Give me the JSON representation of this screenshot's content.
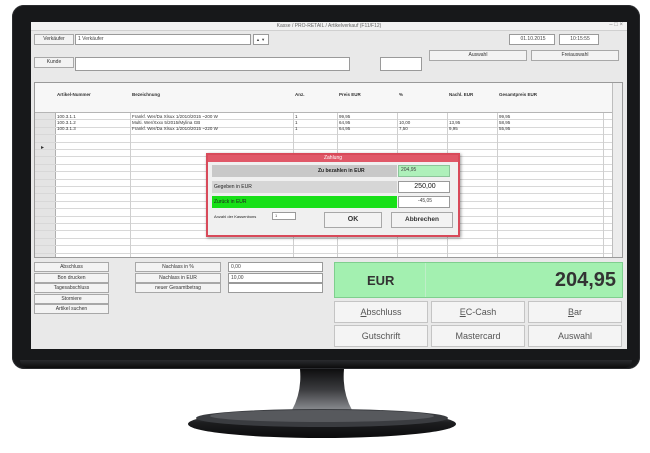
{
  "app": {
    "window_title": "Kasse / PRO-RETAIL / Artikelverkauf (F11/F12)",
    "window_controls": "–  □  ×"
  },
  "toolbar": {
    "verkaeufer_label": "Verkäufer",
    "verkaeufer_value": "1   Verkäufer",
    "verkaeufer_spin": "▲ ▼",
    "kunde_label": "Kunde",
    "kunde_value": "",
    "small_field_value": "",
    "date": "01.10.2015",
    "time": "10:15:55",
    "auswahl_label": "Auswahl",
    "freiauswahl_label": "Freiauswahl"
  },
  "table": {
    "columns": [
      "Artikel-Nummer",
      "Bezeichnung",
      "Anz.",
      "Preis EUR",
      "%",
      "Nachl. EUR",
      "Gesamtpreis EUR"
    ],
    "rows": [
      [
        "100.3.1.1",
        "Frankf. Wer/Da Xlsux  1/2010/2015 ~200 W",
        "1",
        "99,95",
        "",
        "",
        "99,95"
      ],
      [
        "100.3.1.2",
        "Multi.  Wer/Xxxx  5/2015/Mylina   GB",
        "1",
        "64,95",
        "10,00",
        "13,95",
        "58,95"
      ],
      [
        "100.3.1.3",
        "Frankf. Wer/Da Xlsux  1/2010/2015 ~220 W",
        "1",
        "64,95",
        "7,50",
        "9,95",
        "55,95"
      ]
    ],
    "current_row_marker": "▸"
  },
  "dialog": {
    "title": "Zahlung",
    "zu_bezahlen_label": "Zu bezahlen in EUR",
    "zu_bezahlen_value": "204,95",
    "gegeben_label": "Gegeben in EUR",
    "gegeben_value": "250,00",
    "zurueck_label": "Zurück in EUR",
    "zurueck_value": "-45,05",
    "anzahl_label": "Anzahl der Kassenbons",
    "anzahl_value": "1",
    "ok_label": "OK",
    "abbrechen_label": "Abbrechen"
  },
  "bottom_left": {
    "buttons": [
      "Abschluss",
      "Bon drucken",
      "Tagesabschluss",
      "Storniere",
      "Artikel suchen"
    ],
    "mid_buttons": [
      "Nachlass in %",
      "Nachlass in EUR",
      "neuer Gesamtbetrag"
    ],
    "field_values": [
      "0,00",
      "10,00",
      ""
    ]
  },
  "total": {
    "currency": "EUR",
    "amount": "204,95"
  },
  "payment_buttons": [
    {
      "label": "Abschluss",
      "underlined": "A",
      "rest": "bschluss"
    },
    {
      "label": "EC-Cash",
      "underlined": "E",
      "rest": "C-Cash"
    },
    {
      "label": "Bar",
      "underlined": "B",
      "rest": "ar"
    },
    {
      "label": "Gutschrift",
      "underlined": "",
      "rest": "Gutschrift"
    },
    {
      "label": "Mastercard",
      "underlined": "",
      "rest": "Mastercard"
    },
    {
      "label": "Auswahl",
      "underlined": "",
      "rest": "Auswahl"
    }
  ],
  "colors": {
    "total_green": "#a3f0b0",
    "highlight_green": "#18e018",
    "dialog_border": "#d84a5a",
    "bezel": "#17181a"
  }
}
